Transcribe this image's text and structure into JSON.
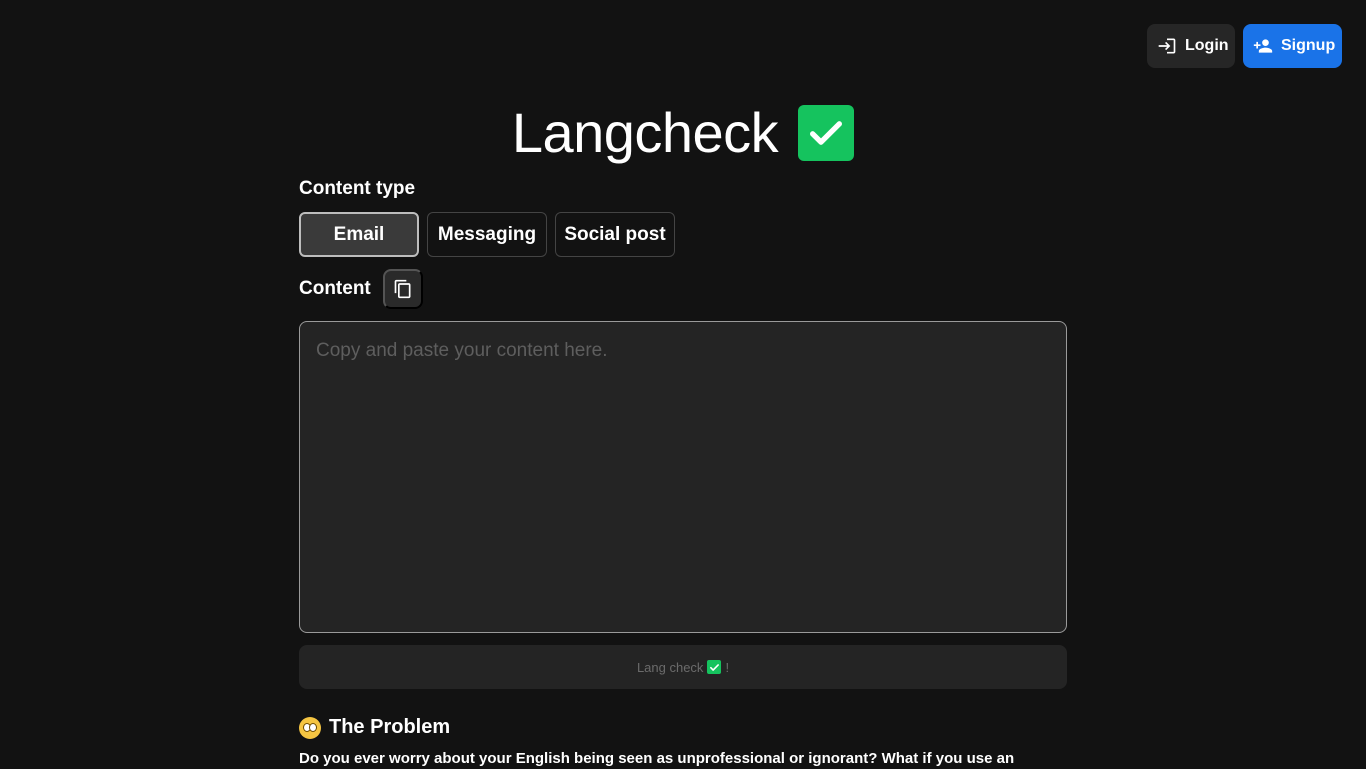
{
  "header": {
    "login_label": "Login",
    "signup_label": "Signup"
  },
  "title": "Langcheck",
  "content_type": {
    "label": "Content type",
    "options": [
      "Email",
      "Messaging",
      "Social post"
    ],
    "selected": "Email"
  },
  "content": {
    "label": "Content",
    "placeholder": "Copy and paste your content here.",
    "value": ""
  },
  "submit": {
    "label": "Lang check",
    "suffix": "!"
  },
  "problem": {
    "title": "The Problem",
    "text": "Do you ever worry about your English being seen as unprofessional or ignorant? What if you use an"
  },
  "colors": {
    "background": "#121212",
    "accent_blue": "#1a73e8",
    "check_green": "#15c35e"
  },
  "icons": {
    "login": "login-icon",
    "signup": "person-add-icon",
    "title_check": "check-box-icon",
    "copy": "copy-icon",
    "problem": "flushed-face-icon"
  }
}
